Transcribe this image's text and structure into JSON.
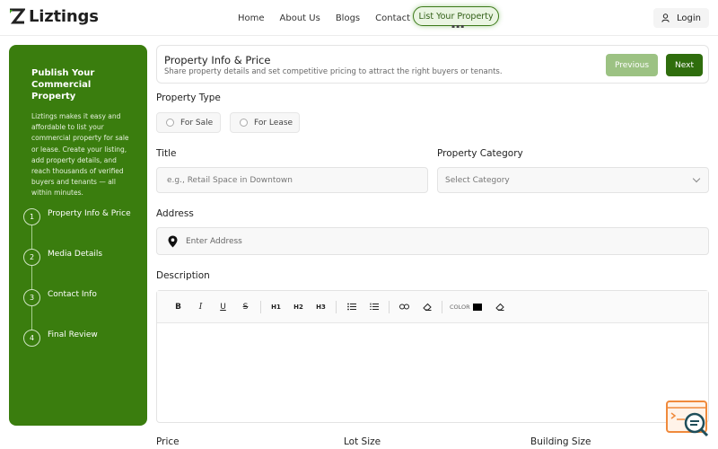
{
  "header": {
    "logo_text": "Liztings",
    "nav": [
      "Home",
      "About Us",
      "Blogs",
      "Contact Us"
    ],
    "cta_label": "List Your Property",
    "login_label": "Login"
  },
  "sidebar": {
    "title": "Publish Your Commercial Property",
    "description": "Liztings makes it easy and affordable to list your commercial property for sale or lease. Create your listing, add property details, and reach thousands of verified buyers and tenants — all within minutes.",
    "steps": [
      {
        "num": "1",
        "label": "Property Info & Price"
      },
      {
        "num": "2",
        "label": "Media Details"
      },
      {
        "num": "3",
        "label": "Contact Info"
      },
      {
        "num": "4",
        "label": "Final Review"
      }
    ]
  },
  "step_header": {
    "title": "Property Info & Price",
    "subtitle": "Share property details and set competitive pricing to attract the right buyers or tenants.",
    "prev_label": "Previous",
    "next_label": "Next"
  },
  "form": {
    "property_type_label": "Property Type",
    "property_type_options": [
      "For Sale",
      "For Lease"
    ],
    "title_label": "Title",
    "title_placeholder": "e.g., Retail Space in Downtown",
    "category_label": "Property Category",
    "category_placeholder": "Select Category",
    "address_label": "Address",
    "address_placeholder": "Enter Address",
    "description_label": "Description",
    "toolbar": {
      "bold": "B",
      "italic": "I",
      "underline": "U",
      "strike": "S",
      "h1": "H1",
      "h2": "H2",
      "h3": "H3",
      "color_label": "COLOR",
      "color_value": "#000000"
    },
    "price_label": "Price",
    "lot_size_label": "Lot Size",
    "building_size_label": "Building Size"
  },
  "colors": {
    "brand_green": "#3a7d0e",
    "next_button": "#2f6d0d",
    "prev_button": "#9cc283",
    "accent_orange": "#f08a3c"
  }
}
